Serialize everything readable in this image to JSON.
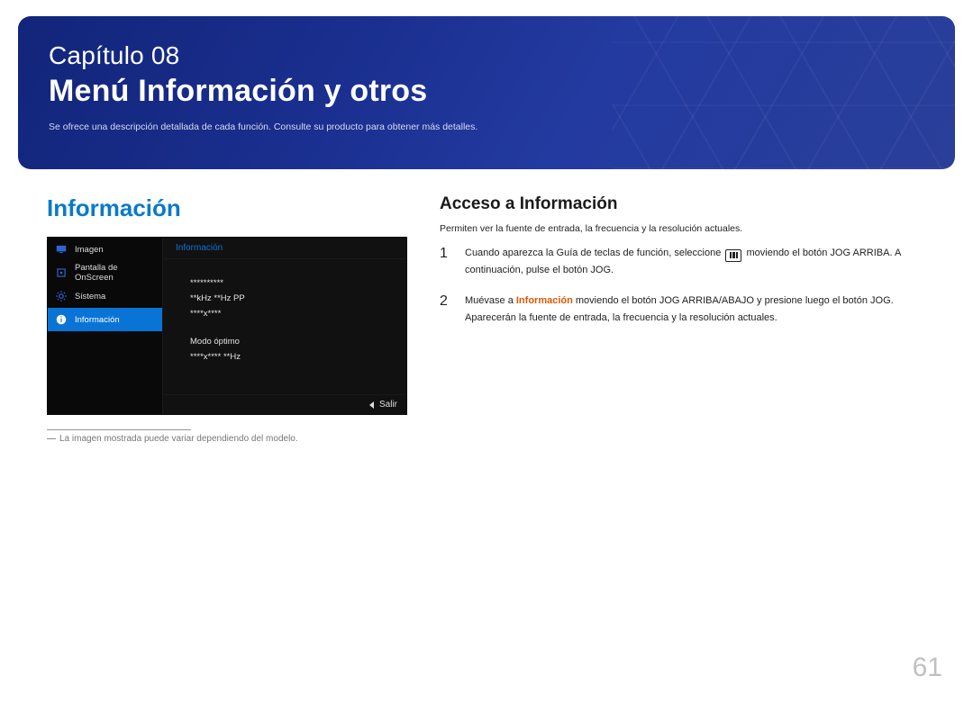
{
  "hero": {
    "chapter": "Capítulo 08",
    "title": "Menú Información y otros",
    "subtitle": "Se ofrece una descripción detallada de cada función. Consulte su producto para obtener más detalles."
  },
  "left": {
    "section_title": "Información",
    "osd": {
      "nav": [
        {
          "label": "Imagen",
          "icon": "monitor-icon"
        },
        {
          "label": "Pantalla de OnScreen",
          "icon": "target-icon"
        },
        {
          "label": "Sistema",
          "icon": "gear-icon"
        },
        {
          "label": "Información",
          "icon": "info-icon",
          "selected": true
        }
      ],
      "body_title": "Información",
      "lines": {
        "l1": "**********",
        "l2": "**kHz **Hz PP",
        "l3": "****x****",
        "l4": "Modo óptimo",
        "l5": "****x**** **Hz"
      },
      "exit_label": "Salir"
    },
    "footnote": "La imagen mostrada puede variar dependiendo del modelo."
  },
  "right": {
    "section_title": "Acceso a Información",
    "intro": "Permiten ver la fuente de entrada, la frecuencia y la resolución actuales.",
    "steps": [
      {
        "n": "1",
        "pre": "Cuando aparezca la Guía de teclas de función, seleccione ",
        "post": " moviendo el botón JOG ARRIBA. A continuación, pulse el botón JOG."
      },
      {
        "n": "2",
        "pre": "Muévase a ",
        "highlight": "Información",
        "post": " moviendo el botón JOG ARRIBA/ABAJO y presione luego el botón JOG. Aparecerán la fuente de entrada, la frecuencia y la resolución actuales."
      }
    ]
  },
  "page_number": "61"
}
